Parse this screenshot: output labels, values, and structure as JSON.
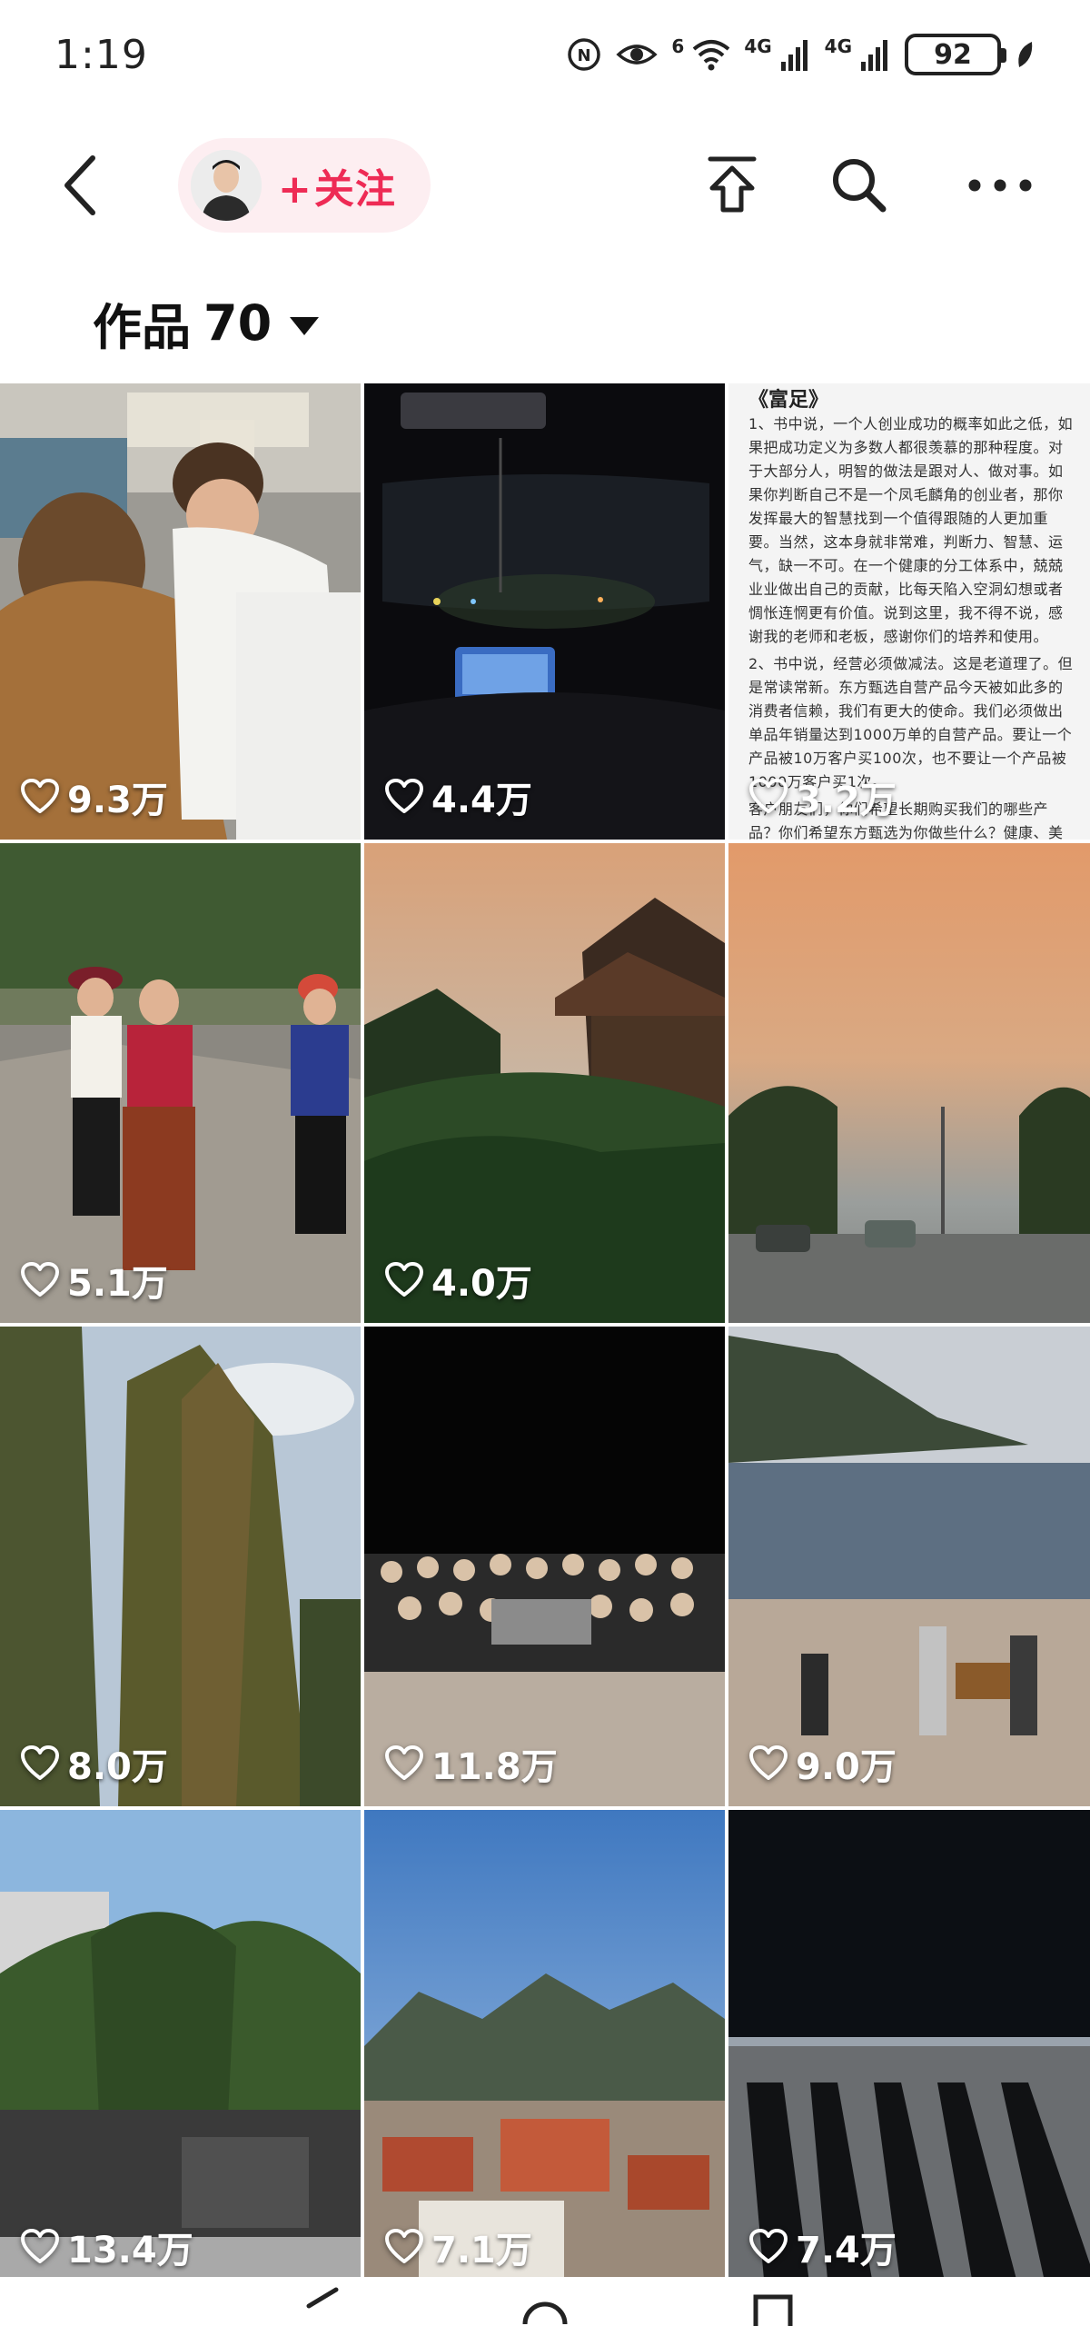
{
  "status_bar": {
    "time": "1:19",
    "net1": "6",
    "net2": "4G",
    "net3": "4G",
    "battery": "92"
  },
  "top_nav": {
    "follow_label": "关注",
    "follow_plus": "+"
  },
  "works": {
    "title": "作品",
    "count": "70"
  },
  "doc_text": {
    "title": "《富足》",
    "p1": "1、书中说，一个人创业成功的概率如此之低，如果把成功定义为多数人都很羡慕的那种程度。对于大部分人，明智的做法是跟对人、做对事。如果你判断自己不是一个凤毛麟角的创业者，那你发挥最大的智慧找到一个值得跟随的人更加重要。当然，这本身就非常难，判断力、智慧、运气，缺一不可。在一个健康的分工体系中，兢兢业业做出自己的贡献，比每天陷入空洞幻想或者惆怅连惘更有价值。说到这里，我不得不说，感谢我的老师和老板，感谢你们的培养和使用。",
    "p2": "2、书中说，经营必须做减法。这是老道理了。但是常读常新。东方甄选自营产品今天被如此多的消费者信赖，我们有更大的使命。我们必须做出单品年销量达到1000万单的自营产品。要让一个产品被10万客户买100次，也不要让一个产品被1000万客户买1次。",
    "p3": "客户朋友们，你们希望长期购买我们的哪些产品？你们希望东方甄选为你做些什么？健康、美好的生活来自……更好的品质、更实惠的价格、更多的生产故事、更丰富的文化品位、更好的生活方式。"
  },
  "posts": [
    {
      "likes": "9.3万",
      "scene": "office"
    },
    {
      "likes": "4.4万",
      "scene": "night-car"
    },
    {
      "likes": "3.2万",
      "scene": "text-doc"
    },
    {
      "likes": "5.1万",
      "scene": "dancers"
    },
    {
      "likes": "4.0万",
      "scene": "sunset-temple"
    },
    {
      "likes": "",
      "scene": "sunset-street"
    },
    {
      "likes": "8.0万",
      "scene": "trees"
    },
    {
      "likes": "11.8万",
      "scene": "night-crowd"
    },
    {
      "likes": "9.0万",
      "scene": "beach-band"
    },
    {
      "likes": "13.4万",
      "scene": "pine-stage"
    },
    {
      "likes": "7.1万",
      "scene": "mountain-town"
    },
    {
      "likes": "7.4万",
      "scene": "shadows"
    }
  ],
  "icons": {
    "back": "back-arrow-icon",
    "share": "share-icon",
    "search": "search-icon",
    "more": "more-icon",
    "heart": "heart-icon"
  },
  "colors": {
    "accent": "#ee2b55",
    "pill_bg": "#fdeef1"
  }
}
